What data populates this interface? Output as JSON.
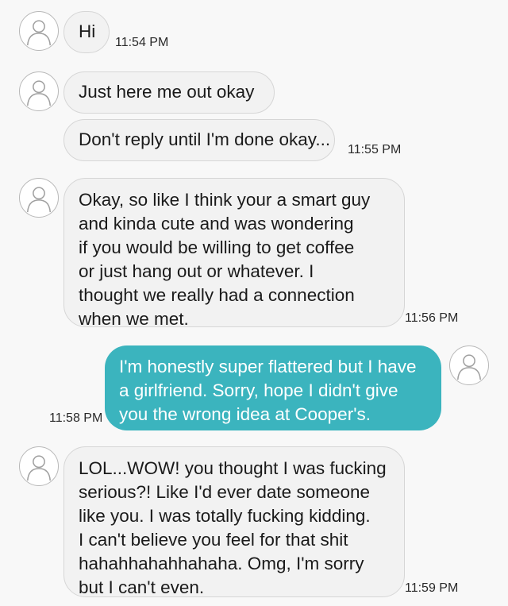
{
  "messages": [
    {
      "direction": "incoming",
      "text": "Hi",
      "time": "11:54 PM"
    },
    {
      "direction": "incoming",
      "text": "Just here me out okay",
      "time": ""
    },
    {
      "direction": "incoming",
      "text": "Don't reply until I'm done okay...",
      "time": "11:55 PM"
    },
    {
      "direction": "incoming",
      "text": "Okay, so like I think your a smart guy\nand kinda cute and was wondering\nif you would be willing to get coffee\nor just hang out or whatever. I\nthought we really had a connection\nwhen we met.",
      "time": "11:56 PM"
    },
    {
      "direction": "outgoing",
      "text": "I'm honestly super flattered but I have\na girlfriend. Sorry, hope I didn't give\nyou the wrong idea at Cooper's.",
      "time": "11:58 PM"
    },
    {
      "direction": "incoming",
      "text": "LOL...WOW! you thought I was fucking\nserious?! Like I'd ever date someone\nlike you. I was totally fucking kidding.\nI can't believe you feel for that shit\nhahahhahahhahaha. Omg, I'm sorry\nbut I can't even.",
      "time": "11:59 PM"
    }
  ],
  "colors": {
    "background": "#f8f8f8",
    "incoming_bubble": "#f2f2f2",
    "outgoing_bubble": "#3bb4be",
    "outgoing_text": "#ffffff"
  },
  "icons": {
    "avatar": "default-person-avatar-icon"
  }
}
